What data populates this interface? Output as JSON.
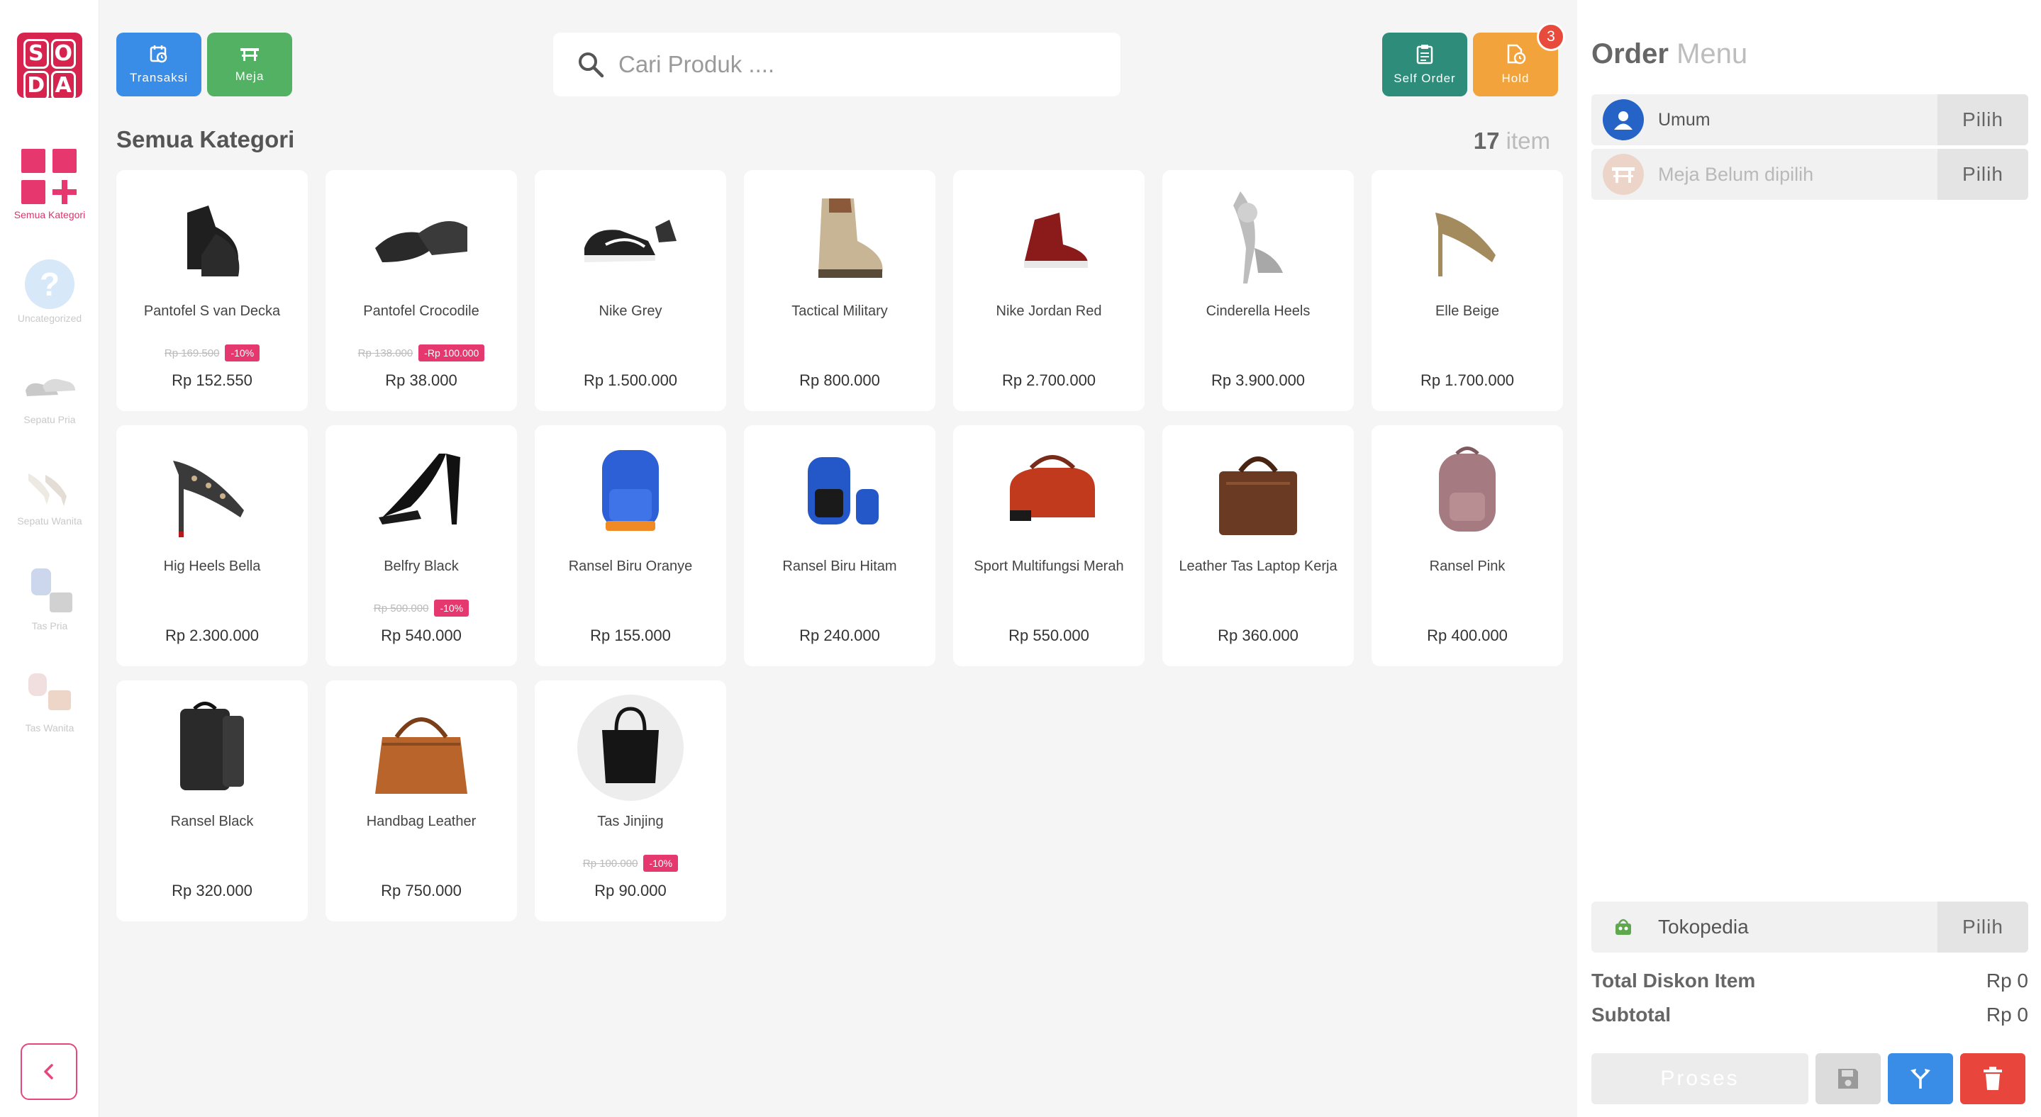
{
  "brand": {
    "logo_letters": [
      "S",
      "O",
      "D",
      "A"
    ]
  },
  "sidebar": {
    "categories": [
      {
        "label": "Semua Kategori",
        "icon": "grid-plus-icon",
        "active": true
      },
      {
        "label": "Uncategorized",
        "icon": "question-icon",
        "active": false
      },
      {
        "label": "Sepatu Pria",
        "icon": "shoes-thumbnail",
        "active": false
      },
      {
        "label": "Sepatu Wanita",
        "icon": "heels-thumbnail",
        "active": false
      },
      {
        "label": "Tas Pria",
        "icon": "backpack-thumbnail",
        "active": false
      },
      {
        "label": "Tas Wanita",
        "icon": "handbag-thumbnail",
        "active": false
      }
    ],
    "collapse_icon": "chevron-left-icon"
  },
  "toolbar": {
    "transaksi_label": "Transaksi",
    "meja_label": "Meja",
    "self_order_label": "Self Order",
    "hold_label": "Hold",
    "hold_count": "3"
  },
  "search": {
    "placeholder": "Cari Produk ...."
  },
  "catalog": {
    "title": "Semua Kategori",
    "count": "17",
    "count_unit": "item",
    "products": [
      {
        "name": "Pantofel S van Decka",
        "old_price": "Rp 169.500",
        "discount": "-10%",
        "price": "Rp 152.550",
        "image": "black-oxford-shoe"
      },
      {
        "name": "Pantofel Crocodile",
        "old_price": "Rp 138.000",
        "discount": "-Rp 100.000",
        "price": "Rp 38.000",
        "image": "black-loafer-shoe"
      },
      {
        "name": "Nike Grey",
        "old_price": "",
        "discount": "",
        "price": "Rp 1.500.000",
        "image": "black-sneaker"
      },
      {
        "name": "Tactical Military",
        "old_price": "",
        "discount": "",
        "price": "Rp 800.000",
        "image": "tan-boot"
      },
      {
        "name": "Nike Jordan Red",
        "old_price": "",
        "discount": "",
        "price": "Rp 2.700.000",
        "image": "red-high-top"
      },
      {
        "name": "Cinderella Heels",
        "old_price": "",
        "discount": "",
        "price": "Rp 3.900.000",
        "image": "silver-heels"
      },
      {
        "name": "Elle Beige",
        "old_price": "",
        "discount": "",
        "price": "Rp 1.700.000",
        "image": "beige-heels"
      },
      {
        "name": "Hig Heels Bella",
        "old_price": "",
        "discount": "",
        "price": "Rp 2.300.000",
        "image": "studded-heels"
      },
      {
        "name": "Belfry Black",
        "old_price": "Rp 500.000",
        "discount": "-10%",
        "price": "Rp 540.000",
        "image": "black-pumps"
      },
      {
        "name": "Ransel Biru Oranye",
        "old_price": "",
        "discount": "",
        "price": "Rp 155.000",
        "image": "blue-backpack"
      },
      {
        "name": "Ransel Biru Hitam",
        "old_price": "",
        "discount": "",
        "price": "Rp 240.000",
        "image": "blue-black-backpack"
      },
      {
        "name": "Sport Multifungsi Merah",
        "old_price": "",
        "discount": "",
        "price": "Rp 550.000",
        "image": "red-duffel"
      },
      {
        "name": "Leather Tas Laptop Kerja",
        "old_price": "",
        "discount": "",
        "price": "Rp 360.000",
        "image": "brown-laptop-bag"
      },
      {
        "name": "Ransel Pink",
        "old_price": "",
        "discount": "",
        "price": "Rp 400.000",
        "image": "pink-backpack"
      },
      {
        "name": "Ransel Black",
        "old_price": "",
        "discount": "",
        "price": "Rp 320.000",
        "image": "black-leather-backpack"
      },
      {
        "name": "Handbag Leather",
        "old_price": "",
        "discount": "",
        "price": "Rp 750.000",
        "image": "tan-handbag"
      },
      {
        "name": "Tas Jinjing",
        "old_price": "Rp 100.000",
        "discount": "-10%",
        "price": "Rp 90.000",
        "image": "black-tote"
      }
    ]
  },
  "order": {
    "title": "Order",
    "title_suffix": "Menu",
    "customer_label": "Umum",
    "table_label": "Meja Belum dipilih",
    "pilih_label": "Pilih",
    "channel_label": "Tokopedia",
    "total_discount_label": "Total Diskon Item",
    "total_discount_value": "Rp 0",
    "subtotal_label": "Subtotal",
    "subtotal_value": "Rp 0",
    "proses_label": "Proses"
  },
  "colors": {
    "brand": "#d6244f",
    "accent_pink": "#e5386f",
    "blue": "#3a8de6",
    "green": "#52b162",
    "teal": "#2e8c7a",
    "orange": "#f2a33b",
    "red": "#e8453c"
  }
}
